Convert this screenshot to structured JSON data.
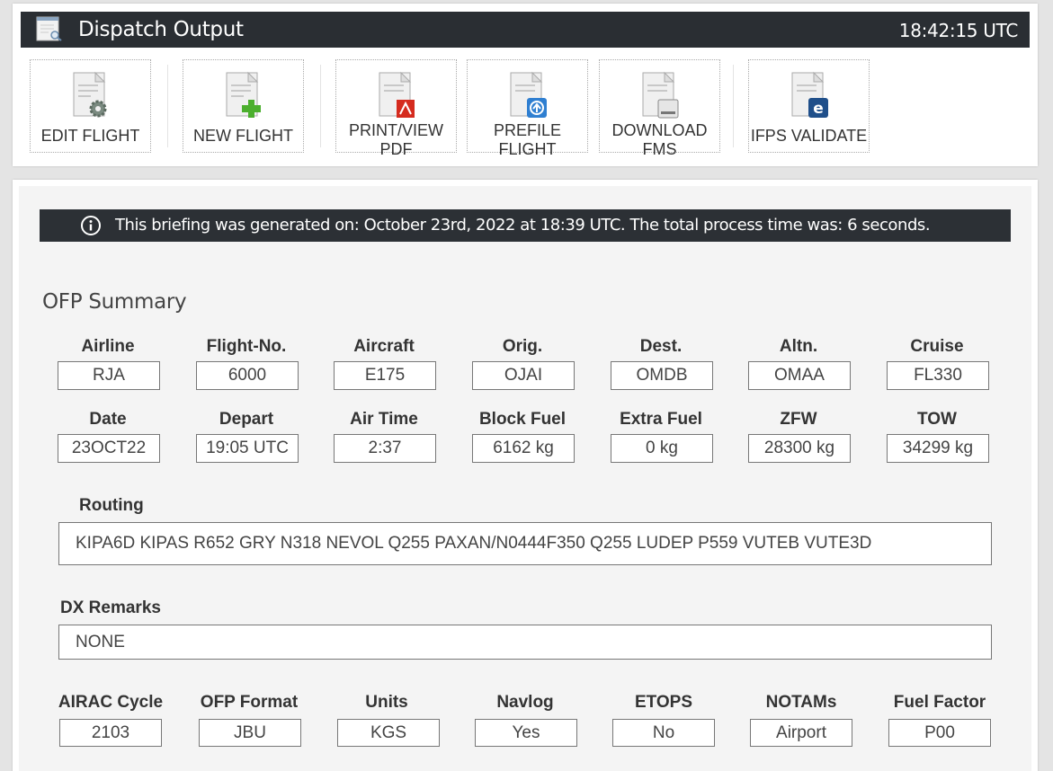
{
  "titlebar": {
    "title": "Dispatch Output",
    "clock": "18:42:15 UTC",
    "icon": "document-magnifier-icon"
  },
  "toolbar": {
    "buttons": [
      {
        "label": "EDIT FLIGHT",
        "icon": "gear-icon"
      },
      {
        "label": "NEW FLIGHT",
        "icon": "plus-icon"
      },
      {
        "label": "PRINT/VIEW\nPDF",
        "icon": "pdf-icon"
      },
      {
        "label": "PREFILE\nFLIGHT",
        "icon": "upload-icon"
      },
      {
        "label": "DOWNLOAD\nFMS",
        "icon": "drive-icon"
      },
      {
        "label": "IFPS VALIDATE",
        "icon": "eurocontrol-icon"
      }
    ]
  },
  "banner": {
    "text": "This briefing was generated on: October 23rd, 2022 at 18:39 UTC.   The total process time was: 6 seconds.",
    "icon": "info-icon"
  },
  "summary": {
    "title": "OFP Summary",
    "row1": [
      {
        "label": "Airline",
        "value": "RJA"
      },
      {
        "label": "Flight-No.",
        "value": "6000"
      },
      {
        "label": "Aircraft",
        "value": "E175"
      },
      {
        "label": "Orig.",
        "value": "OJAI"
      },
      {
        "label": "Dest.",
        "value": "OMDB"
      },
      {
        "label": "Altn.",
        "value": "OMAA"
      },
      {
        "label": "Cruise",
        "value": "FL330"
      }
    ],
    "row2": [
      {
        "label": "Date",
        "value": "23OCT22"
      },
      {
        "label": "Depart",
        "value": "19:05 UTC"
      },
      {
        "label": "Air Time",
        "value": "2:37"
      },
      {
        "label": "Block Fuel",
        "value": "6162 kg"
      },
      {
        "label": "Extra Fuel",
        "value": "0 kg"
      },
      {
        "label": "ZFW",
        "value": "28300 kg"
      },
      {
        "label": "TOW",
        "value": "34299 kg"
      }
    ],
    "routing": {
      "label": "Routing",
      "value": "KIPA6D KIPAS R652 GRY N318 NEVOL Q255 PAXAN/N0444F350 Q255 LUDEP P559 VUTEB VUTE3D"
    },
    "remarks": {
      "label": "DX Remarks",
      "value": "NONE"
    },
    "row3": [
      {
        "label": "AIRAC Cycle",
        "value": "2103"
      },
      {
        "label": "OFP Format",
        "value": "JBU"
      },
      {
        "label": "Units",
        "value": "KGS"
      },
      {
        "label": "Navlog",
        "value": "Yes"
      },
      {
        "label": "ETOPS",
        "value": "No"
      },
      {
        "label": "NOTAMs",
        "value": "Airport"
      },
      {
        "label": "Fuel Factor",
        "value": "P00"
      }
    ]
  }
}
